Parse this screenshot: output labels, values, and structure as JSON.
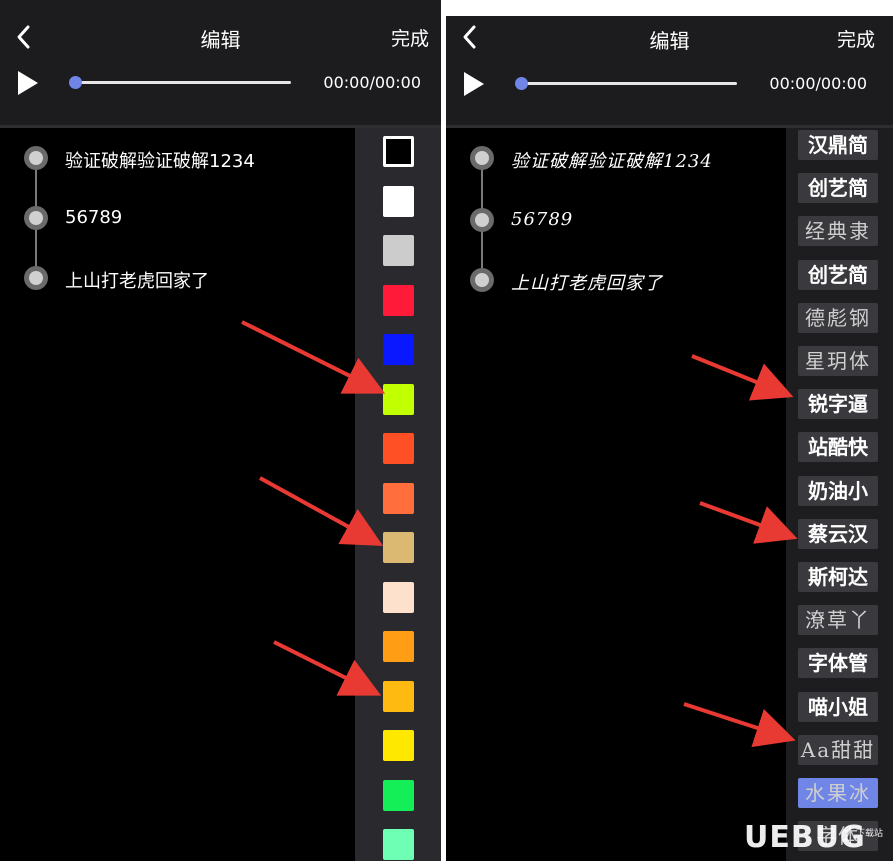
{
  "left": {
    "header": {
      "title": "编辑",
      "done_label": "完成",
      "time": "00:00/00:00"
    },
    "timeline": [
      {
        "text": "验证破解验证破解1234"
      },
      {
        "text": "56789"
      },
      {
        "text": "上山打老虎回家了"
      }
    ],
    "colors": [
      "#000000",
      "#ffffff",
      "#cccccc",
      "#ff1a3a",
      "#0a18ff",
      "#c2ff00",
      "#ff4f24",
      "#ff6e3c",
      "#dbb973",
      "#fde1cc",
      "#ff9e14",
      "#ffba12",
      "#ffe800",
      "#14ef57",
      "#6effb5"
    ],
    "selected_color_index": 0
  },
  "right": {
    "header": {
      "title": "编辑",
      "done_label": "完成",
      "time": "00:00/00:00"
    },
    "timeline": [
      {
        "text": "验证破解验证破解1234"
      },
      {
        "text": "56789"
      },
      {
        "text": "上山打老虎回家了"
      }
    ],
    "fonts": [
      "汉鼎简",
      "创艺简",
      "经典隶",
      "创艺简",
      "德彪钢",
      "星玥体",
      "锐字逼",
      "站酷快",
      "奶油小",
      "蔡云汉",
      "斯柯达",
      "潦草丫",
      "字体管",
      "喵小姐",
      "Aa甜甜",
      "水果冰",
      "字体"
    ],
    "selected_font_index": 15
  },
  "watermark": {
    "text": "UEBUG",
    "sub": "下载站"
  },
  "accent_color": "#6f86e6",
  "arrow_color": "#e83a33"
}
